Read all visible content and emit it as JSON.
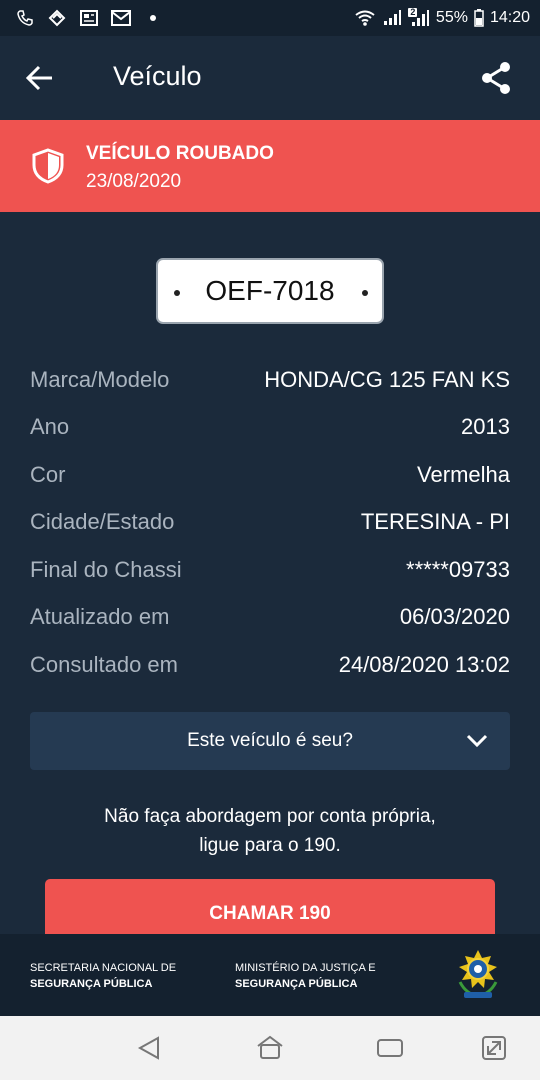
{
  "status_bar": {
    "battery": "55%",
    "time": "14:20",
    "sim_badge": "2",
    "icons": [
      "call-log-icon",
      "transfer-icon",
      "news-icon",
      "gmail-icon",
      "dot-icon",
      "wifi-icon",
      "signal-icon",
      "signal-2-icon",
      "battery-icon"
    ]
  },
  "app_bar": {
    "title": "Veículo",
    "back_icon": "arrow-left-icon",
    "share_icon": "share-icon"
  },
  "alert": {
    "title": "VEÍCULO ROUBADO",
    "date": "23/08/2020",
    "icon": "shield-icon",
    "color": "#ef5350"
  },
  "plate": {
    "number": "OEF-7018"
  },
  "details": [
    {
      "label": "Marca/Modelo",
      "value": "HONDA/CG 125 FAN KS"
    },
    {
      "label": "Ano",
      "value": "2013"
    },
    {
      "label": "Cor",
      "value": "Vermelha"
    },
    {
      "label": "Cidade/Estado",
      "value": "TERESINA - PI"
    },
    {
      "label": "Final do Chassi",
      "value": "*****09733"
    },
    {
      "label": "Atualizado em",
      "value": "06/03/2020"
    },
    {
      "label": "Consultado em",
      "value": "24/08/2020 13:02"
    }
  ],
  "owner_question": {
    "label": "Este veículo é seu?",
    "icon": "chevron-down-icon"
  },
  "warning": {
    "line1": "Não faça abordagem por conta própria,",
    "line2": "ligue para o 190."
  },
  "call_button": {
    "label": "CHAMAR 190"
  },
  "footer": {
    "left_line1": "SECRETARIA NACIONAL DE",
    "left_line2": "SEGURANÇA PÚBLICA",
    "right_line1": "MINISTÉRIO DA JUSTIÇA E",
    "right_line2": "SEGURANÇA PÚBLICA",
    "emblem": "coat-of-arms-icon"
  },
  "nav_bar": {
    "icons": [
      "back-triangle-icon",
      "home-icon",
      "recents-icon",
      "screen-rotate-icon"
    ]
  },
  "colors": {
    "background": "#1b2a3b",
    "accent": "#ef5350",
    "dropdown": "#253a52",
    "label": "#aab4bf"
  }
}
